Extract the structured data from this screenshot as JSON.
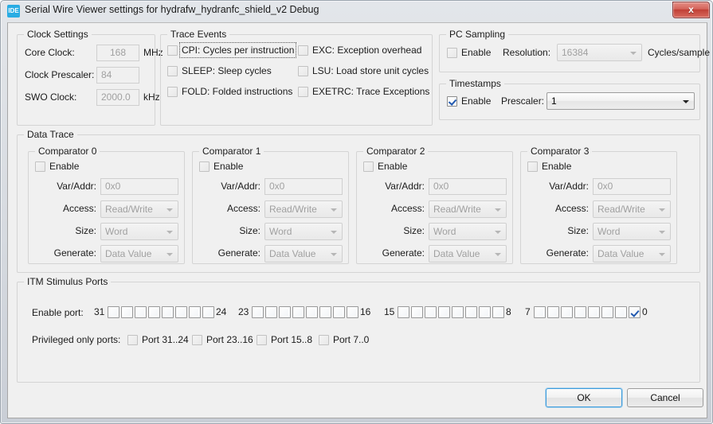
{
  "window": {
    "title": "Serial Wire Viewer settings for hydrafw_hydranfc_shield_v2 Debug",
    "icon_label": "IDE",
    "close_label": "x",
    "accent_color": "#2159b0",
    "title_icon_color": "#29ace3"
  },
  "clock_settings": {
    "title": "Clock Settings",
    "fields": [
      {
        "label": "Core Clock:",
        "value": "168",
        "unit": "MHz"
      },
      {
        "label": "Clock Prescaler:",
        "value": "84",
        "unit": ""
      },
      {
        "label": "SWO Clock:",
        "value": "2000.0",
        "unit": "kHz"
      }
    ]
  },
  "trace_events": {
    "title": "Trace Events",
    "items": [
      {
        "label": "CPI: Cycles per instruction",
        "checked": false,
        "focused": true
      },
      {
        "label": "SLEEP: Sleep cycles",
        "checked": false,
        "focused": false
      },
      {
        "label": "FOLD: Folded instructions",
        "checked": false,
        "focused": false
      },
      {
        "label": "EXC: Exception overhead",
        "checked": false,
        "focused": false
      },
      {
        "label": "LSU: Load store unit cycles",
        "checked": false,
        "focused": false
      },
      {
        "label": "EXETRC: Trace Exceptions",
        "checked": false,
        "focused": false
      }
    ]
  },
  "pc_sampling": {
    "title": "PC Sampling",
    "enable_label": "Enable",
    "enable_checked": false,
    "resolution_label": "Resolution:",
    "resolution_value": "16384",
    "units_label": "Cycles/sample"
  },
  "timestamps": {
    "title": "Timestamps",
    "enable_label": "Enable",
    "enable_checked": true,
    "prescaler_label": "Prescaler:",
    "prescaler_value": "1"
  },
  "data_trace": {
    "title": "Data Trace",
    "comparators": [
      {
        "title": "Comparator 0",
        "enable_label": "Enable",
        "enable_checked": false,
        "var_addr_label": "Var/Addr:",
        "var_addr_value": "0x0",
        "access_label": "Access:",
        "access_value": "Read/Write",
        "size_label": "Size:",
        "size_value": "Word",
        "generate_label": "Generate:",
        "generate_value": "Data Value"
      },
      {
        "title": "Comparator 1",
        "enable_label": "Enable",
        "enable_checked": false,
        "var_addr_label": "Var/Addr:",
        "var_addr_value": "0x0",
        "access_label": "Access:",
        "access_value": "Read/Write",
        "size_label": "Size:",
        "size_value": "Word",
        "generate_label": "Generate:",
        "generate_value": "Data Value"
      },
      {
        "title": "Comparator 2",
        "enable_label": "Enable",
        "enable_checked": false,
        "var_addr_label": "Var/Addr:",
        "var_addr_value": "0x0",
        "access_label": "Access:",
        "access_value": "Read/Write",
        "size_label": "Size:",
        "size_value": "Word",
        "generate_label": "Generate:",
        "generate_value": "Data Value"
      },
      {
        "title": "Comparator 3",
        "enable_label": "Enable",
        "enable_checked": false,
        "var_addr_label": "Var/Addr:",
        "var_addr_value": "0x0",
        "access_label": "Access:",
        "access_value": "Read/Write",
        "size_label": "Size:",
        "size_value": "Word",
        "generate_label": "Generate:",
        "generate_value": "Data Value"
      }
    ]
  },
  "itm": {
    "title": "ITM Stimulus Ports",
    "enable_port_label": "Enable port:",
    "groups": [
      {
        "high": "31",
        "low": "24",
        "checked": [
          false,
          false,
          false,
          false,
          false,
          false,
          false,
          false
        ]
      },
      {
        "high": "23",
        "low": "16",
        "checked": [
          false,
          false,
          false,
          false,
          false,
          false,
          false,
          false
        ]
      },
      {
        "high": "15",
        "low": "8",
        "checked": [
          false,
          false,
          false,
          false,
          false,
          false,
          false,
          false
        ]
      },
      {
        "high": "7",
        "low": "0",
        "checked": [
          false,
          false,
          false,
          false,
          false,
          false,
          false,
          true
        ]
      }
    ],
    "privileged_label": "Privileged only ports:",
    "privileged": [
      {
        "label": "Port 31..24",
        "checked": false
      },
      {
        "label": "Port 23..16",
        "checked": false
      },
      {
        "label": "Port 15..8",
        "checked": false
      },
      {
        "label": "Port 7..0",
        "checked": false
      }
    ]
  },
  "footer": {
    "ok_label": "OK",
    "cancel_label": "Cancel"
  }
}
